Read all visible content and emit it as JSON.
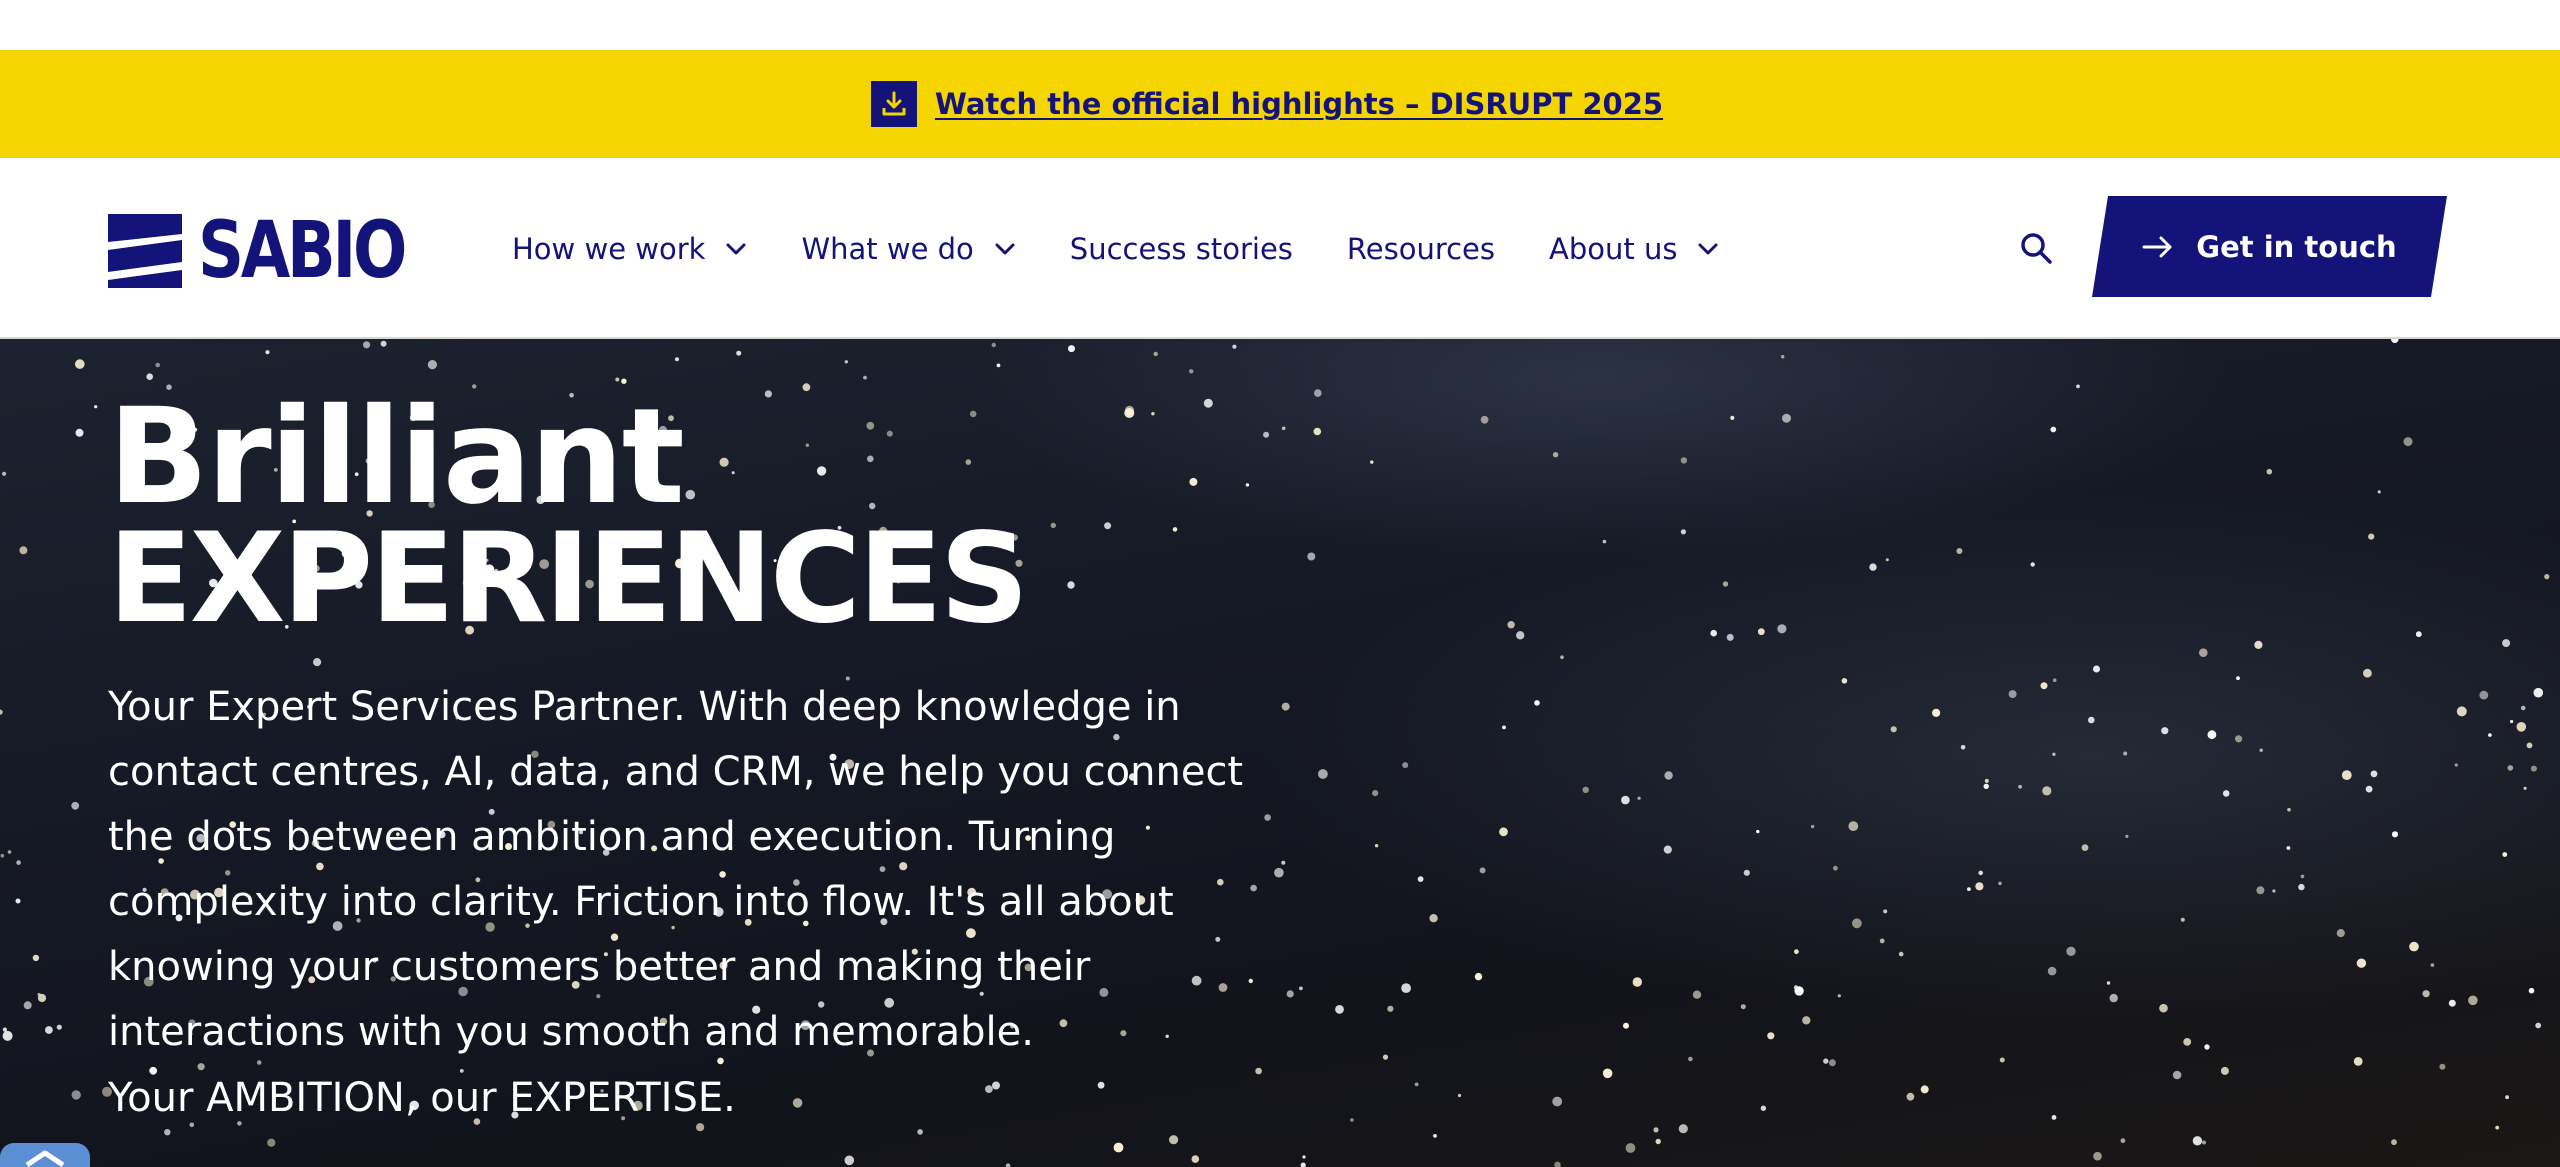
{
  "banner": {
    "link_text": "Watch the official highlights – DISRUPT 2025",
    "icon": "download-icon",
    "background": "#f5d500"
  },
  "header": {
    "logo_text": "SABIO",
    "nav": [
      {
        "label": "How we work",
        "has_dropdown": true
      },
      {
        "label": "What we do",
        "has_dropdown": true
      },
      {
        "label": "Success stories",
        "has_dropdown": false
      },
      {
        "label": "Resources",
        "has_dropdown": false
      },
      {
        "label": "About us",
        "has_dropdown": true
      }
    ],
    "search_icon": "search-icon",
    "cta_label": "Get in touch",
    "cta_icon": "arrow-right-icon"
  },
  "hero": {
    "title_line1": "Brilliant",
    "title_line2": "EXPERIENCES",
    "description": "Your Expert Services Partner. With deep knowledge in contact centres, AI, data, and CRM, we help you connect the dots between ambition and execution. Turning complexity into clarity. Friction into flow. It's all about knowing your customers better and making their interactions with you smooth and memorable.",
    "tagline": "Your AMBITION, our EXPERTISE."
  },
  "colors": {
    "brand_navy": "#14137a",
    "banner_yellow": "#f5d500",
    "hero_text": "#ffffff"
  }
}
